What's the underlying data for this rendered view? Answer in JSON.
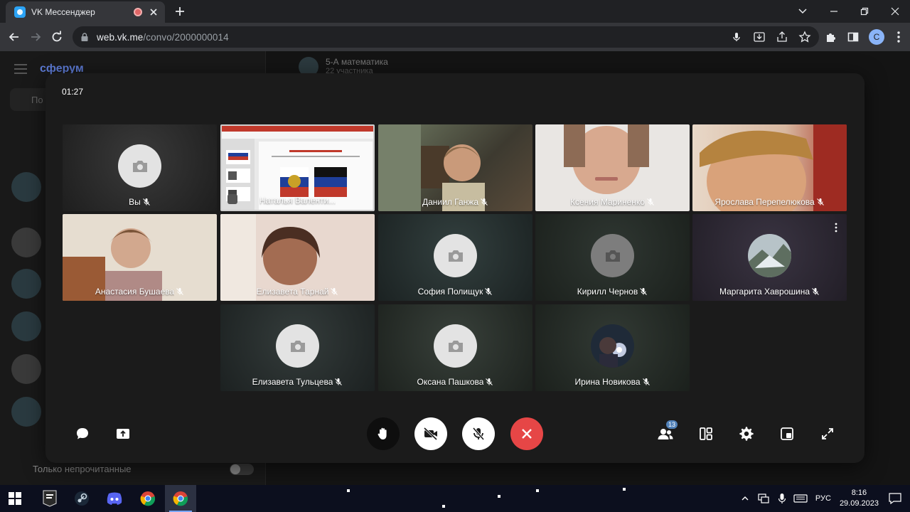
{
  "browser": {
    "tab_title": "VK Мессенджер",
    "url_host": "web.vk.me",
    "url_path": "/convo/2000000014",
    "profile_initial": "C"
  },
  "app": {
    "logo": "сферум",
    "search_placeholder": "По",
    "chat_title": "5-А математика",
    "chat_subtitle": "22 участника",
    "unread_only_label": "Только непрочитанные"
  },
  "call": {
    "timer": "01:27",
    "participants_count": "13",
    "tiles": [
      {
        "name": "Вы",
        "kind": "placeholder"
      },
      {
        "name": "Наталья Валенти...",
        "kind": "screen"
      },
      {
        "name": "Даниил Ганжа",
        "kind": "video"
      },
      {
        "name": "Ксения Мариненко",
        "kind": "video"
      },
      {
        "name": "Ярослава Перепелюкова",
        "kind": "video"
      },
      {
        "name": "Анастасия Бушаева",
        "kind": "video"
      },
      {
        "name": "Елизавета Тарнай",
        "kind": "video"
      },
      {
        "name": "София Полищук",
        "kind": "placeholder"
      },
      {
        "name": "Кирилл Чернов",
        "kind": "placeholder-dark"
      },
      {
        "name": "Маргарита Хаврошина",
        "kind": "avatar"
      },
      {
        "name": "Елизавета Тульцева",
        "kind": "placeholder"
      },
      {
        "name": "Оксана Пашкова",
        "kind": "placeholder"
      },
      {
        "name": "Ирина Новикова",
        "kind": "avatar"
      }
    ]
  },
  "icons": {
    "chat": "chat-bubble-icon",
    "share": "share-screen-icon",
    "hand": "raise-hand-icon",
    "video_off": "video-off-icon",
    "mic_off": "mic-off-icon",
    "end": "end-call-icon",
    "participants": "participants-icon",
    "layout": "layout-icon",
    "settings": "gear-icon",
    "pip": "pip-icon",
    "fullscreen": "fullscreen-icon"
  },
  "colors": {
    "end_call": "#e64646",
    "accent": "#5181b8",
    "overlay_bg": "#1b1b1b"
  },
  "taskbar": {
    "language": "РУС",
    "time": "8:16",
    "date": "29.09.2023"
  }
}
